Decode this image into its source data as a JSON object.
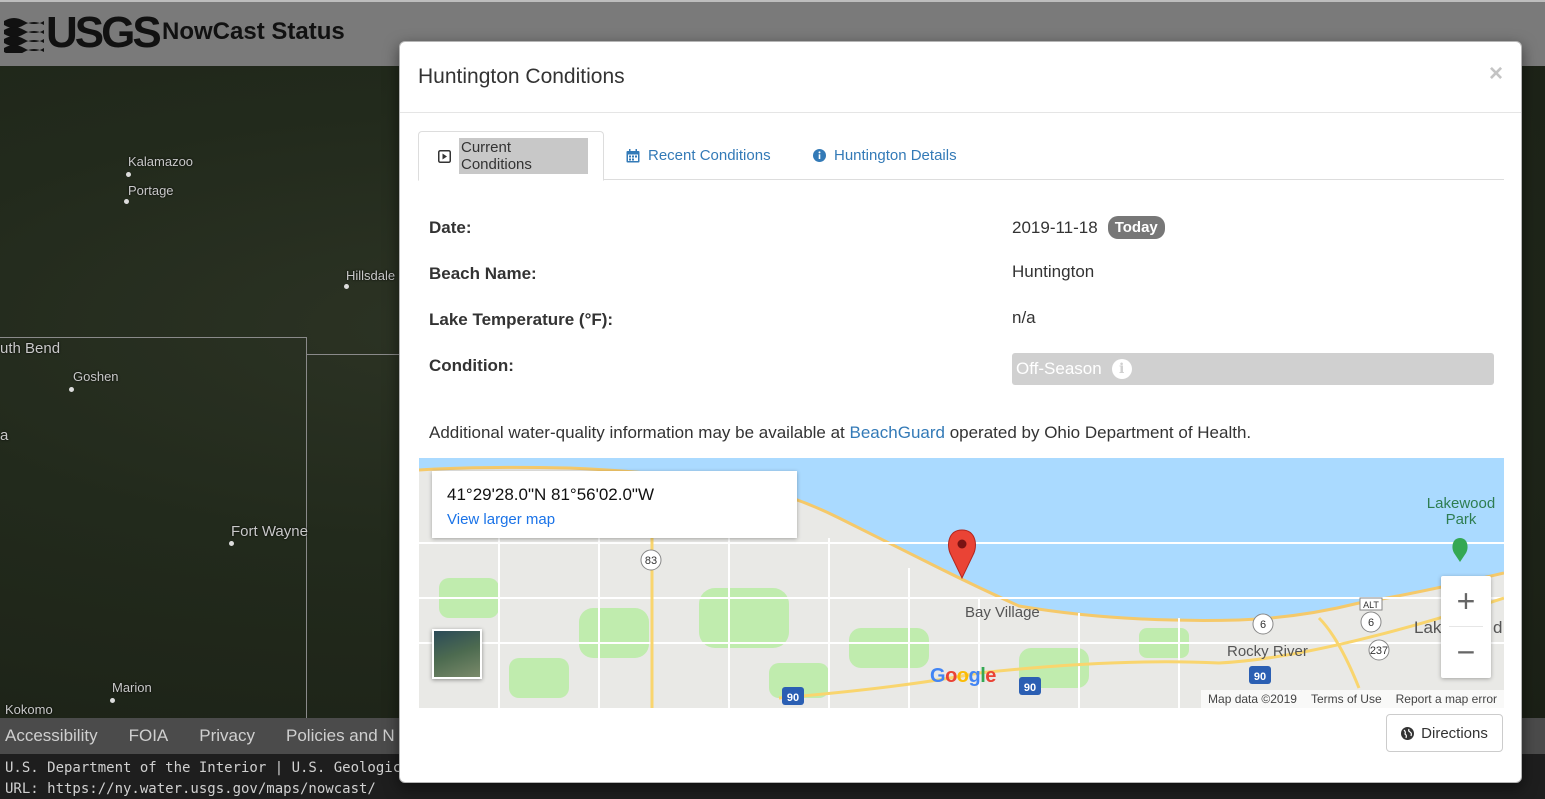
{
  "site": {
    "logo_text": "USGS",
    "title": "NowCast Status"
  },
  "background_map": {
    "places": [
      "Kalamazoo",
      "Portage",
      "Hillsdale",
      "uth Bend",
      "Goshen",
      "a",
      "Fort Wayne",
      "Marion",
      "Kokomo"
    ]
  },
  "footer": {
    "links": [
      "Accessibility",
      "FOIA",
      "Privacy",
      "Policies and N"
    ],
    "line1": "U.S. Department of the Interior | U.S. Geological Su",
    "line2": "URL: https://ny.water.usgs.gov/maps/nowcast/"
  },
  "modal": {
    "title": "Huntington Conditions",
    "close": "×",
    "tabs": [
      {
        "label": "Current Conditions",
        "icon": "play-square-icon",
        "active": true
      },
      {
        "label": "Recent Conditions",
        "icon": "calendar-icon",
        "active": false
      },
      {
        "label": "Huntington Details",
        "icon": "info-circle-icon",
        "active": false
      }
    ],
    "fields": {
      "date_label": "Date:",
      "date_value": "2019-11-18",
      "date_badge": "Today",
      "beach_label": "Beach Name:",
      "beach_value": "Huntington",
      "temp_label": "Lake Temperature (°F):",
      "temp_value": "n/a",
      "condition_label": "Condition:",
      "condition_value": "Off-Season"
    },
    "additional": {
      "before": "Additional water-quality information may be available at ",
      "link": "BeachGuard",
      "after": " operated by Ohio Department of Health."
    },
    "map": {
      "coords": "41°29'28.0\"N 81°56'02.0\"W",
      "view_larger": "View larger map",
      "places": [
        "Bay Village",
        "Rocky River",
        "Lakewood Park",
        "Lak",
        "d"
      ],
      "shields": [
        "83",
        "6",
        "6",
        "237",
        "90",
        "90",
        "90",
        "ALT"
      ],
      "zoom_in": "+",
      "zoom_out": "−",
      "google": "Google",
      "attribution": [
        "Map data ©2019",
        "Terms of Use",
        "Report a map error"
      ],
      "colors": {
        "water": "#aadaff",
        "land": "#e9e9e6",
        "park": "#c0ecae",
        "highway": "#f9d56e",
        "pin": "#ea4335"
      }
    },
    "directions_label": "Directions"
  }
}
